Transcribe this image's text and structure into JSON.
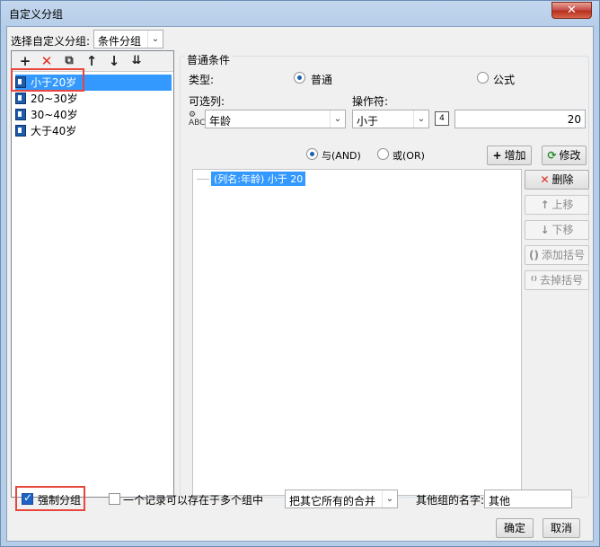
{
  "window": {
    "title": "自定义分组",
    "close_label": "✕"
  },
  "select_group": {
    "label": "选择自定义分组:",
    "value": "条件分组"
  },
  "toolbar": {
    "add_icon": "plus-icon",
    "delete_icon": "red-x-icon",
    "copy_icon": "copy-icon",
    "up_icon": "arrow-up-icon",
    "down_icon": "arrow-down-icon",
    "sort_icon": "sort-icon"
  },
  "groups": [
    {
      "label": "小于20岁",
      "selected": true
    },
    {
      "label": "20~30岁",
      "selected": false
    },
    {
      "label": "30~40岁",
      "selected": false
    },
    {
      "label": "大于40岁",
      "selected": false
    }
  ],
  "condition": {
    "section_title": "普通条件",
    "type_label": "类型:",
    "type_normal": "普通",
    "type_formula": "公式",
    "type_selected": "普通",
    "column_label": "可选列:",
    "column_value": "年龄",
    "operator_label": "操作符:",
    "operator_value": "小于",
    "value": "20",
    "and_label": "与(AND)",
    "or_label": "或(OR)",
    "logic_selected": "AND",
    "add_button": "增加",
    "modify_button": "修改",
    "list": [
      "(列名:年龄) 小于 20"
    ],
    "delete_button": "删除",
    "move_up_button": "上移",
    "move_down_button": "下移",
    "add_bracket_button": "添加括号",
    "remove_bracket_button": "去掉括号"
  },
  "bottom": {
    "force_group_label": "强制分组",
    "force_group_checked": true,
    "multi_group_label": "一个记录可以存在于多个组中",
    "multi_group_checked": false,
    "merge_option": "把其它所有的合并",
    "other_name_label": "其他组的名字:",
    "other_name_value": "其他",
    "ok_button": "确定",
    "cancel_button": "取消"
  }
}
